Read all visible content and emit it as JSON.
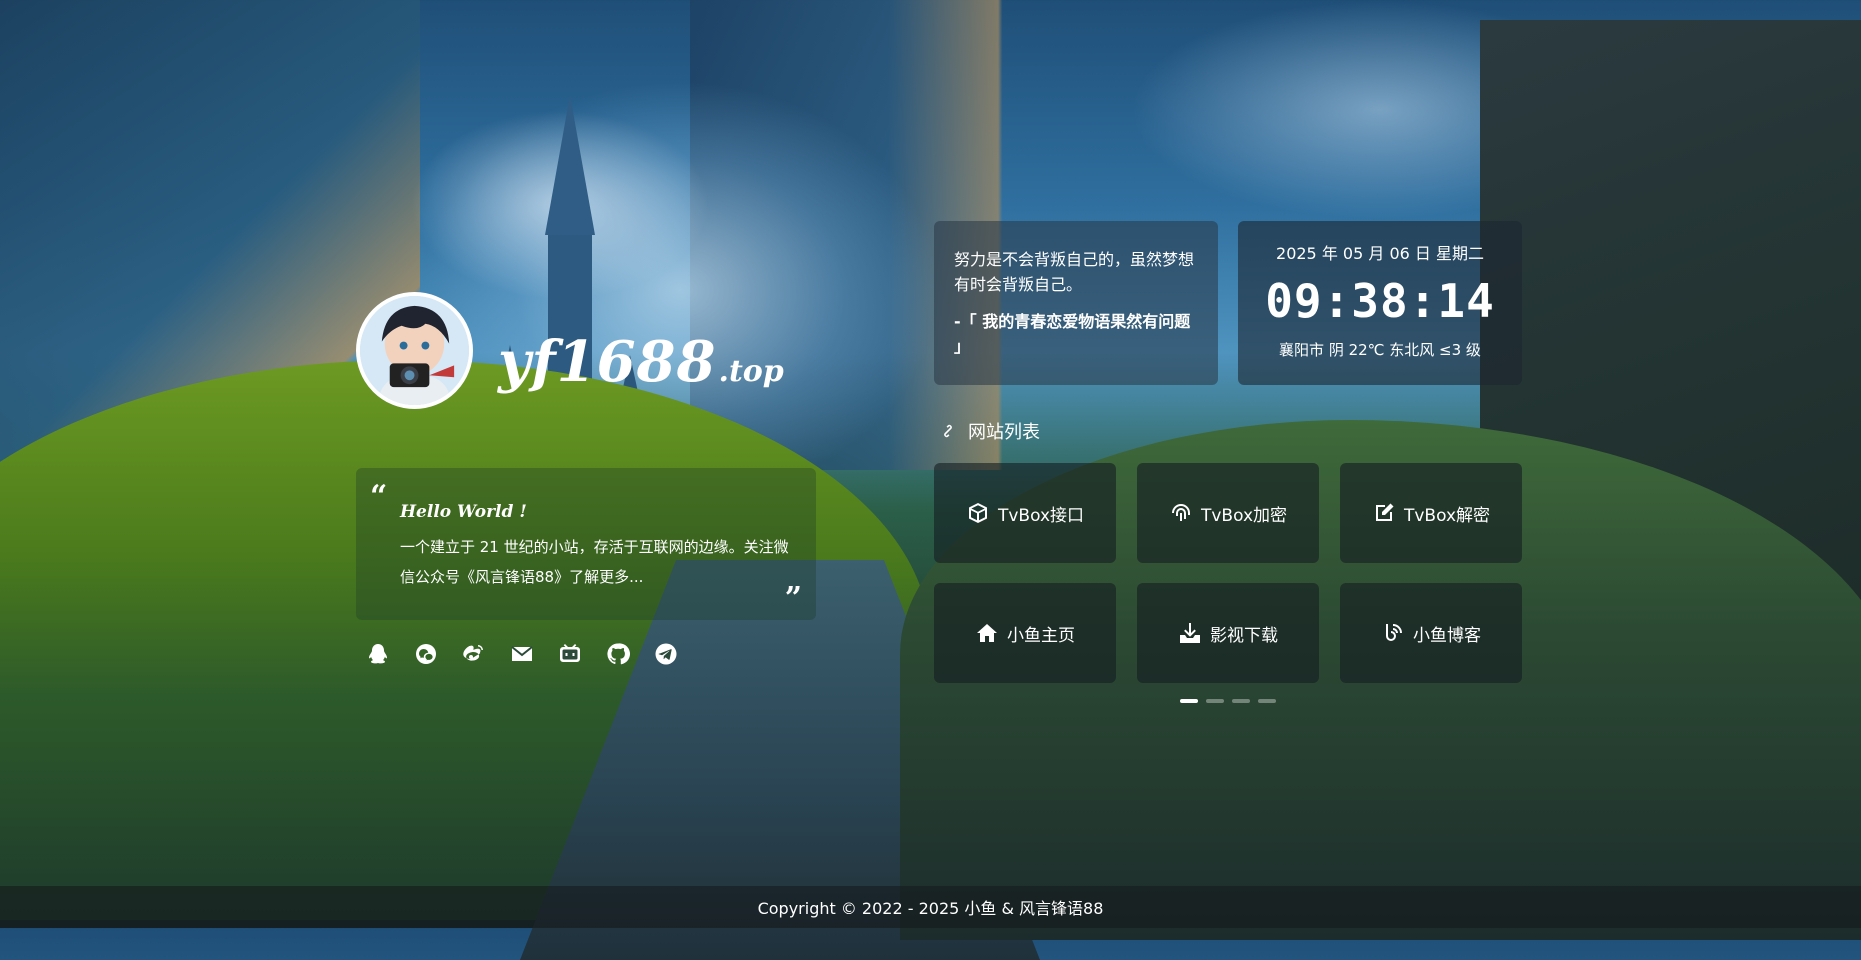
{
  "profile": {
    "brand_main": "yf1688",
    "brand_tld": ".top",
    "intro_title": "Hello World !",
    "intro_text": "一个建立于 21 世纪的小站，存活于互联网的边缘。关注微信公众号《风言锋语88》了解更多...",
    "social_icons": [
      "qq-icon",
      "wechat-icon",
      "weibo-icon",
      "email-icon",
      "bilibili-icon",
      "github-icon",
      "telegram-icon"
    ]
  },
  "quote": {
    "text": "努力是不会背叛自己的，虽然梦想有时会背叛自己。",
    "source": "-「 我的青春恋爱物语果然有问题 」"
  },
  "clock": {
    "date": "2025 年 05 月 06 日 星期二",
    "time": "09:38:14",
    "weather": "襄阳市 阴 22℃ 东北风 ≤3 级"
  },
  "sites": {
    "title": "网站列表",
    "items": [
      {
        "label": "TvBox接口",
        "icon": "cube-icon"
      },
      {
        "label": "TvBox加密",
        "icon": "fingerprint-icon"
      },
      {
        "label": "TvBox解密",
        "icon": "edit-icon"
      },
      {
        "label": "小鱼主页",
        "icon": "home-icon"
      },
      {
        "label": "影视下载",
        "icon": "download-icon"
      },
      {
        "label": "小鱼博客",
        "icon": "blog-icon"
      }
    ],
    "pages": 4,
    "active_page": 1
  },
  "footer": {
    "text": "Copyright © 2022 - 2025 小鱼 & 风言锋语88"
  }
}
